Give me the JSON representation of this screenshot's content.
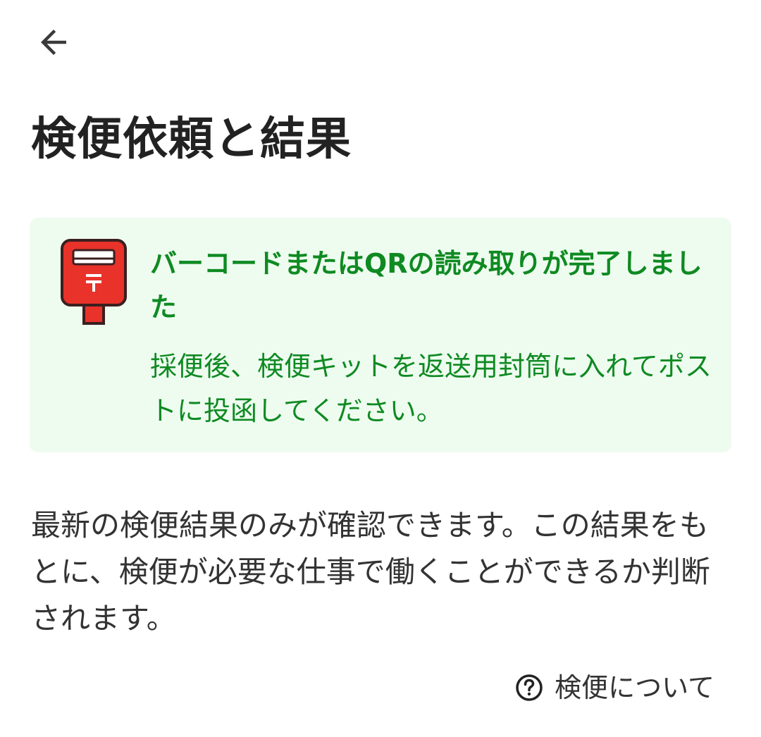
{
  "header": {
    "back_icon": "arrow-left-icon",
    "title": "検便依頼と結果"
  },
  "notice": {
    "icon": "postbox-icon",
    "accent_color": "#0f8a22",
    "background_color": "#eefcf0",
    "heading": "バーコードまたはQRの読み取りが完了しました",
    "body": "採便後、検便キットを返送用封筒に入れてポストに投函してください。"
  },
  "main": {
    "description": "最新の検便結果のみが確認できます。この結果をもとに、検便が必要な仕事で働くことができるか判断されます。"
  },
  "help_link": {
    "icon": "question-circle-icon",
    "label": "検便について"
  }
}
